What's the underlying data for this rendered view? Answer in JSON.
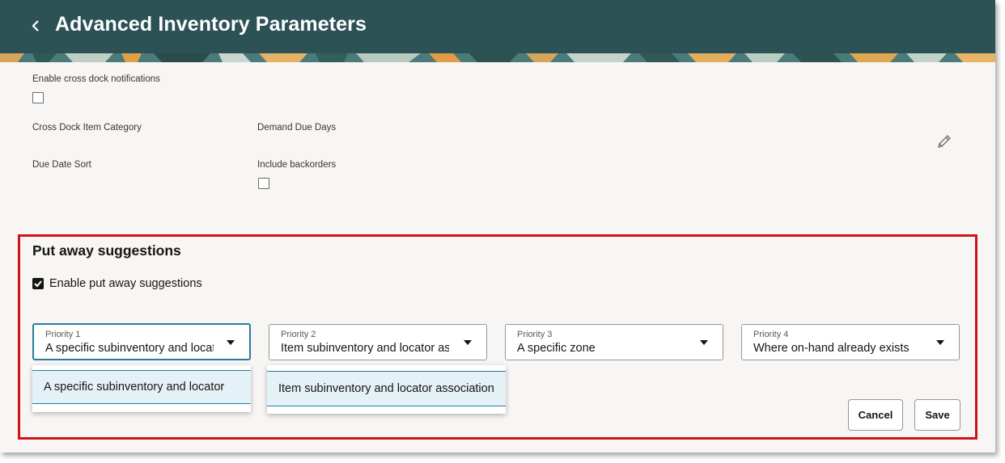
{
  "header": {
    "title": "Advanced Inventory Parameters",
    "back_icon": "chevron-left-icon",
    "background_color": "#2c5256"
  },
  "cross_dock": {
    "enable_notifications_label": "Enable cross dock notifications",
    "enable_notifications_checked": false,
    "item_category_label": "Cross Dock Item Category",
    "demand_due_days_label": "Demand Due Days",
    "due_date_sort_label": "Due Date Sort",
    "include_backorders_label": "Include backorders",
    "include_backorders_checked": false,
    "edit_icon": "pencil-icon"
  },
  "put_away": {
    "title": "Put away suggestions",
    "enable_label": "Enable put away suggestions",
    "enable_checked": true,
    "priorities": [
      {
        "label": "Priority 1",
        "value": "A specific subinventory and locator"
      },
      {
        "label": "Priority 2",
        "value": "Item subinventory and locator association"
      },
      {
        "label": "Priority 3",
        "value": "A specific zone"
      },
      {
        "label": "Priority 4",
        "value": "Where on-hand already exists"
      }
    ],
    "dropdown_1_option": "A specific subinventory and locator",
    "dropdown_2_option": "Item subinventory and locator association",
    "highlight_color": "#d0121b"
  },
  "buttons": {
    "cancel": "Cancel",
    "save": "Save"
  }
}
